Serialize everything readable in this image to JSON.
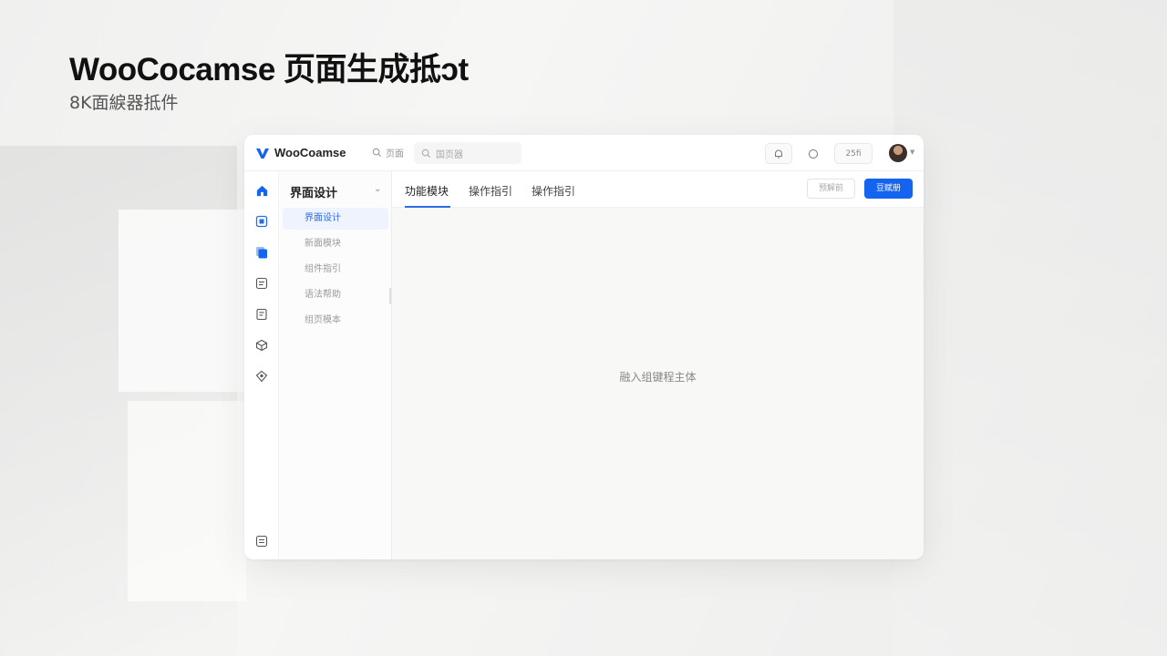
{
  "hero": {
    "title": "WooCocamse 页面生成抵ɔt",
    "subtitle": "8K面綟器抵件"
  },
  "app": {
    "logo_text": "WooCoamse",
    "search_label": "页面",
    "search_placeholder": "国页器",
    "top_count": "25fi",
    "brand_color": "#1464f0",
    "icons": [
      "home-icon",
      "dashboard-icon",
      "pages-icon",
      "list-icon",
      "document-icon",
      "cube-icon",
      "plugin-icon",
      "settings-icon",
      "bell-icon",
      "help-icon"
    ]
  },
  "subnav": {
    "title": "界面设计",
    "items": [
      {
        "label": "界面设计"
      },
      {
        "label": "新面模块"
      },
      {
        "label": "组件指引"
      },
      {
        "label": "语法帮助"
      },
      {
        "label": "组页模本"
      }
    ]
  },
  "tabs": [
    {
      "label": "功能模块"
    },
    {
      "label": "操作指引"
    },
    {
      "label": "操作指引"
    }
  ],
  "actions": {
    "secondary": "预解前",
    "primary": "豆赋册"
  },
  "canvas": {
    "hint": "融入组键程主体"
  }
}
